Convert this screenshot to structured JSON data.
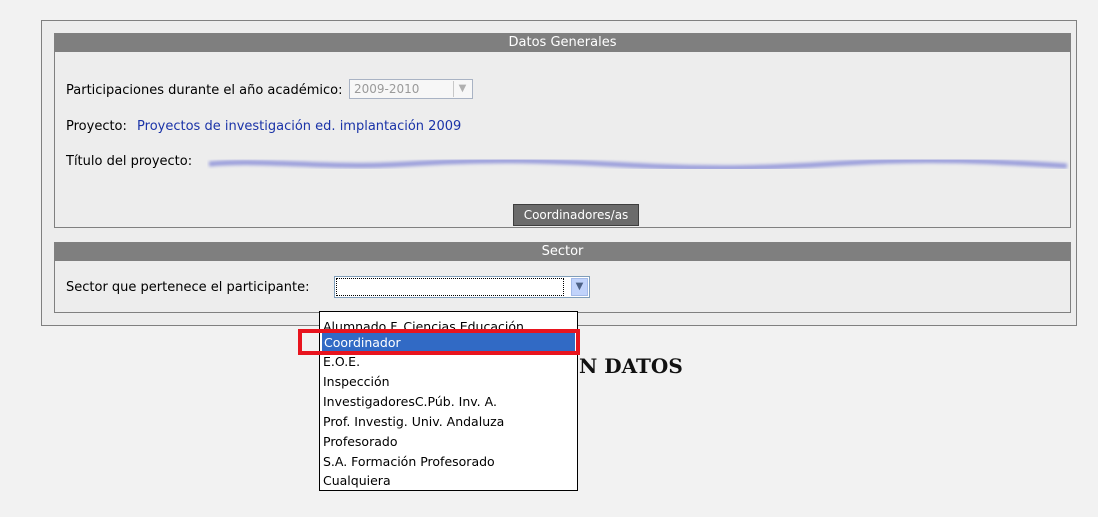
{
  "general": {
    "header": "Datos Generales",
    "participations_label": "Participaciones durante el año académico:",
    "academic_year_value": "2009-2010",
    "project_label": "Proyecto:",
    "project_value": "Proyectos de investigación ed. implantación 2009",
    "project_title_label": "Título del proyecto:",
    "coordinators_button": "Coordinadores/as"
  },
  "sector": {
    "header": "Sector",
    "label": "Sector que pertenece el participante:",
    "value": "",
    "options": [
      "Alumnado F. Ciencias Educación",
      "Coordinador",
      "E.O.E.",
      "Inspección",
      "InvestigadoresC.Púb. Inv. A.",
      "Prof. Investig. Univ. Andaluza",
      "Profesorado",
      "S.A. Formación Profesorado",
      "Cualquiera"
    ],
    "highlighted_option": "Coordinador"
  },
  "background_heading": "N DATOS",
  "colors": {
    "header_bg": "#7f7f7f",
    "selection": "#316ac5",
    "highlight_border": "#e8141e",
    "link": "#1a33a8"
  }
}
